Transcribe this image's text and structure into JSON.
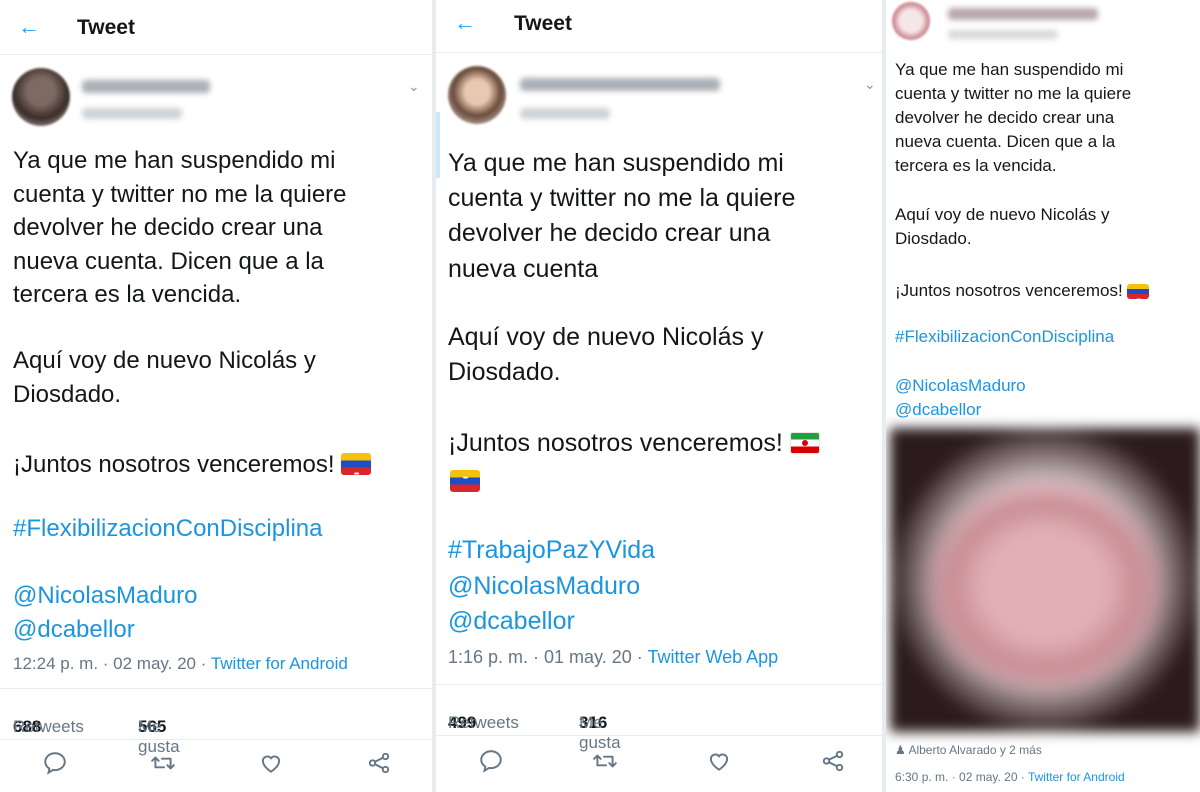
{
  "colors": {
    "accent": "#1da1f2",
    "link": "#1b95e0",
    "muted": "#657786",
    "border": "#e6ecf0"
  },
  "panel1": {
    "header_title": "Tweet",
    "body": {
      "p1": "Ya que me han suspendido mi\ncuenta y twitter no me la quiere\ndevolver he decido crear una\nnueva cuenta. Dicen que a la\ntercera es la vencida.",
      "p2": "Aquí voy de nuevo Nicolás y\nDiosdado.",
      "p3": "¡Juntos nosotros venceremos! ",
      "hashtag": "#FlexibilizacionConDisciplina",
      "mention1": "@NicolasMaduro",
      "mention2": "@dcabellor"
    },
    "meta": {
      "time": "12:24 p. m. · 02 may. 20 · ",
      "source": "Twitter for Android"
    },
    "stats": {
      "retweets_count": "688",
      "retweets_label": "Retweets",
      "likes_count": "565",
      "likes_label": "Me gusta"
    },
    "icons": [
      "reply-icon",
      "retweet-icon",
      "like-icon",
      "share-icon"
    ]
  },
  "panel2": {
    "header_title": "Tweet",
    "body": {
      "p1": "Ya que me han suspendido mi\ncuenta y twitter no me la quiere\ndevolver he decido crear una\nnueva cuenta",
      "p2": "Aquí voy de nuevo Nicolás y\nDiosdado.",
      "p3": "¡Juntos nosotros venceremos! ",
      "hashtag": "#TrabajoPazYVida",
      "mention1": "@NicolasMaduro",
      "mention2": "@dcabellor"
    },
    "meta": {
      "time": "1:16 p. m. · 01 may. 20 · ",
      "source": "Twitter Web App"
    },
    "stats": {
      "retweets_count": "499",
      "retweets_label": "Retweets",
      "likes_count": "316",
      "likes_label": "Me gusta"
    },
    "icons": [
      "reply-icon",
      "retweet-icon",
      "like-icon",
      "share-icon"
    ]
  },
  "panel3": {
    "body": {
      "p1": "Ya que me han suspendido mi\ncuenta y twitter no me la quiere\ndevolver he decido crear una\nnueva cuenta. Dicen que a la\ntercera es la vencida.",
      "p2": "Aquí voy de nuevo Nicolás y\nDiosdado.",
      "p3": "¡Juntos nosotros venceremos! ",
      "hashtag": "#FlexibilizacionConDisciplina",
      "mention1": "@NicolasMaduro",
      "mention2": "@dcabellor"
    },
    "tagged": "Alberto Alvarado y 2 más",
    "meta": {
      "time": "6:30 p. m. · 02 may. 20 · ",
      "source": "Twitter for Android"
    }
  }
}
